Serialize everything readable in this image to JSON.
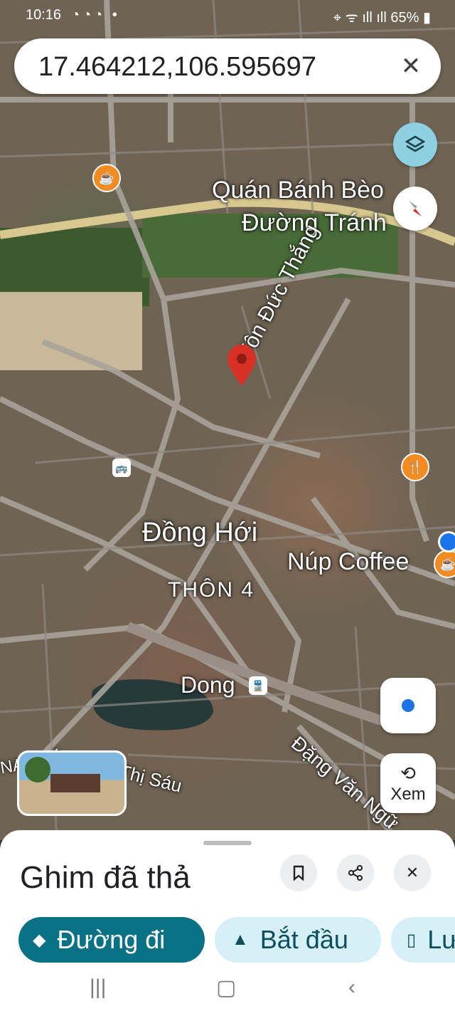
{
  "status_bar": {
    "time": "10:16",
    "battery": "65%"
  },
  "search": {
    "value": "17.464212,106.595697"
  },
  "map": {
    "labels": {
      "quan_banh_beo": "Quán Bánh Bèo",
      "duong_tranh": "Đường Tránh",
      "ton_duc_thang": "Tôn Đức Thắng",
      "dong_hoi": "Đồng Hới",
      "nup_coffee": "Núp Coffee",
      "thon_4": "THÔN 4",
      "dong_station": "Dong",
      "dang_van_ngu": "Đặng Văn Ngữ",
      "thi_sau": "Thị Sáu",
      "nam_ly": "NAM LÝ"
    }
  },
  "street_view": {
    "label": "Xem"
  },
  "sheet": {
    "title": "Ghim đã thả",
    "chips": {
      "directions": "Đường đi",
      "start": "Bắt đầu",
      "save": "Lưu"
    }
  },
  "colors": {
    "accent": "#0b7285",
    "chip_light": "#d7f0f7",
    "pin": "#d93025",
    "poi": "#f28b20",
    "location": "#1a73e8"
  }
}
